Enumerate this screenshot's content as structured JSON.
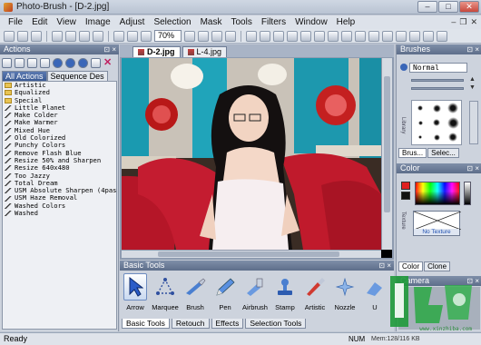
{
  "window": {
    "title": "Photo-Brush - [D-2.jpg]",
    "min": "–",
    "max": "□",
    "close": "✕"
  },
  "menu": [
    "File",
    "Edit",
    "View",
    "Image",
    "Adjust",
    "Selection",
    "Mask",
    "Tools",
    "Filters",
    "Window",
    "Help"
  ],
  "menu_right": {
    "min": "–",
    "restore": "❐",
    "close": "✕"
  },
  "toolbar": {
    "zoom": "70%"
  },
  "actions": {
    "title": "Actions",
    "tabs": [
      "All Actions",
      "Sequence Des"
    ],
    "items": [
      {
        "label": "Artistic",
        "type": "folder"
      },
      {
        "label": "Equalized",
        "type": "folder"
      },
      {
        "label": "Special",
        "type": "folder"
      },
      {
        "label": "Little Planet",
        "type": "action"
      },
      {
        "label": "Make Colder",
        "type": "action"
      },
      {
        "label": "Make Warmer",
        "type": "action"
      },
      {
        "label": "Mixed Hue",
        "type": "action"
      },
      {
        "label": "Old Colorized",
        "type": "action"
      },
      {
        "label": "Punchy Colors",
        "type": "action"
      },
      {
        "label": "Remove Flash Blue",
        "type": "action"
      },
      {
        "label": "Resize 50% and Sharpen",
        "type": "action"
      },
      {
        "label": "Resize 640x480",
        "type": "action"
      },
      {
        "label": "Too Jazzy",
        "type": "action"
      },
      {
        "label": "Total Dream",
        "type": "action"
      },
      {
        "label": "USM Absolute Sharpen (4pass",
        "type": "action"
      },
      {
        "label": "USM Haze Removal",
        "type": "action"
      },
      {
        "label": "Washed Colors",
        "type": "action"
      },
      {
        "label": "Washed",
        "type": "action"
      }
    ]
  },
  "documents": {
    "tabs": [
      "D-2.jpg",
      "L-4.jpg"
    ],
    "active": 0
  },
  "basic_tools": {
    "title": "Basic Tools",
    "tools": [
      "Arrow",
      "Marquee",
      "Brush",
      "Pen",
      "Airbrush",
      "Stamp",
      "Artistic",
      "Nozzle",
      "U"
    ],
    "active": 0,
    "tabs": [
      "Basic Tools",
      "Retouch",
      "Effects",
      "Selection Tools"
    ]
  },
  "brushes": {
    "title": "Brushes",
    "blend_mode": "Normal",
    "tabs": [
      "Brus...",
      "Selec..."
    ],
    "side_label": "Library"
  },
  "color": {
    "title": "Color",
    "fg": "#e02020",
    "bg": "#111111",
    "texture_label": "No Texture",
    "tabs": [
      "Color",
      "Clone"
    ],
    "side_label": "Texture"
  },
  "camera": {
    "title": "Camera"
  },
  "status": {
    "left": "Ready",
    "num": "NUM",
    "info": "Mem:128/116 KB"
  },
  "watermark": {
    "text": "www.xinzhiba.com"
  }
}
